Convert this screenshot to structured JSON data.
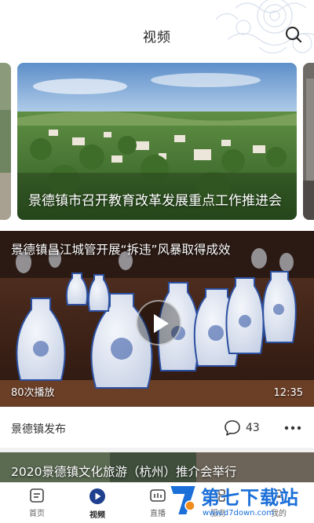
{
  "header": {
    "title": "视频",
    "search_icon": "search-icon"
  },
  "carousel": {
    "slides": [
      {
        "caption": "景德镇市召开教育改革发展重点工作推进会"
      }
    ]
  },
  "video": {
    "title": "景德镇昌江城管开展“拆违”风暴取得成效",
    "play_count": "80次播放",
    "duration": "12:35"
  },
  "meta": {
    "source": "景德镇发布",
    "comment_count": "43",
    "comment_icon": "comment-bubble-icon",
    "more_icon": "more-dots-icon"
  },
  "next_item": {
    "title": "2020景德镇文化旅游（杭州）推介会举行"
  },
  "nav": {
    "items": [
      {
        "label": "首页",
        "icon": "home-icon"
      },
      {
        "label": "视频",
        "icon": "video-icon",
        "active": true
      },
      {
        "label": "直播",
        "icon": "live-icon"
      },
      {
        "label": "服务",
        "icon": "service-icon"
      },
      {
        "label": "我的",
        "icon": "profile-icon"
      }
    ]
  },
  "watermark": {
    "name": "第七下载站",
    "url": "www.d7down.com"
  },
  "colors": {
    "accent": "#1a6fd8",
    "text": "#222222",
    "divider": "#f2f2f2"
  }
}
